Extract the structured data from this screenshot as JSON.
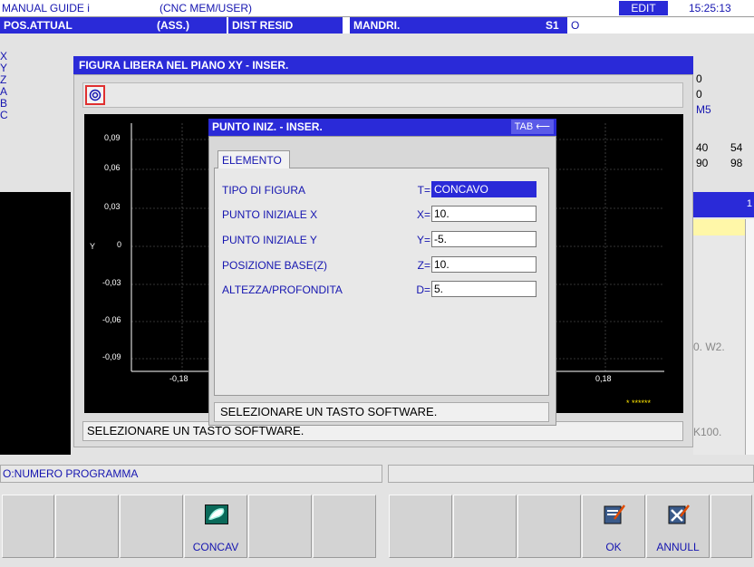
{
  "topbar": {
    "app": "MANUAL GUIDE i",
    "path": "(CNC  MEM/USER)",
    "mode": "EDIT",
    "time": "15:25:13"
  },
  "posbar": {
    "pos": "POS.ATTUAL",
    "ass": "(ASS.)",
    "dist": "DIST RESID",
    "mandri": "MANDRI.",
    "s1": "S1",
    "o": "O"
  },
  "axes": [
    "X",
    "Y",
    "Z",
    "A",
    "B",
    "C"
  ],
  "right_vals": {
    "r1": "0",
    "r2": "0",
    "r3": "M5",
    "r4a": "40",
    "r4b": "54",
    "r5a": "90",
    "r5b": "98",
    "w2": "0. W2.",
    "k100": "K100.",
    "num1": "1"
  },
  "dialog": {
    "title": "FIGURA LIBERA NEL PIANO XY - INSER.",
    "status": "SELEZIONARE UN TASTO SOFTWARE."
  },
  "plot": {
    "yticks": [
      "0,09",
      "0,06",
      "0,03",
      "0",
      "-0,03",
      "-0,06",
      "-0,09"
    ],
    "xticks": [
      "-0,18",
      "0,18"
    ],
    "ylabel": "Y",
    "marker": "* ******"
  },
  "popup": {
    "title": "PUNTO INIZ. - INSER.",
    "tab_hint": "TAB ⟵",
    "tab": "ELEMENTO",
    "fields": [
      {
        "label": "TIPO DI FIGURA",
        "key": "T=",
        "value": "CONCAVO"
      },
      {
        "label": "PUNTO INIZIALE X",
        "key": "X=",
        "value": "10."
      },
      {
        "label": "PUNTO INIZIALE Y",
        "key": "Y=",
        "value": "-5."
      },
      {
        "label": "POSIZIONE BASE(Z)",
        "key": "Z=",
        "value": "10."
      },
      {
        "label": "ALTEZZA/PROFONDITA",
        "key": "D=",
        "value": "5."
      }
    ],
    "status": "SELEZIONARE UN TASTO SOFTWARE."
  },
  "bottom": {
    "program": "O:NUMERO PROGRAMMA"
  },
  "softkeys": {
    "concav": "CONCAV",
    "ok": "OK",
    "annull": "ANNULL"
  },
  "colors": {
    "title_blue": "#2a2ad8",
    "label_blue": "#1515b0",
    "highlight": "#fff7a8"
  }
}
